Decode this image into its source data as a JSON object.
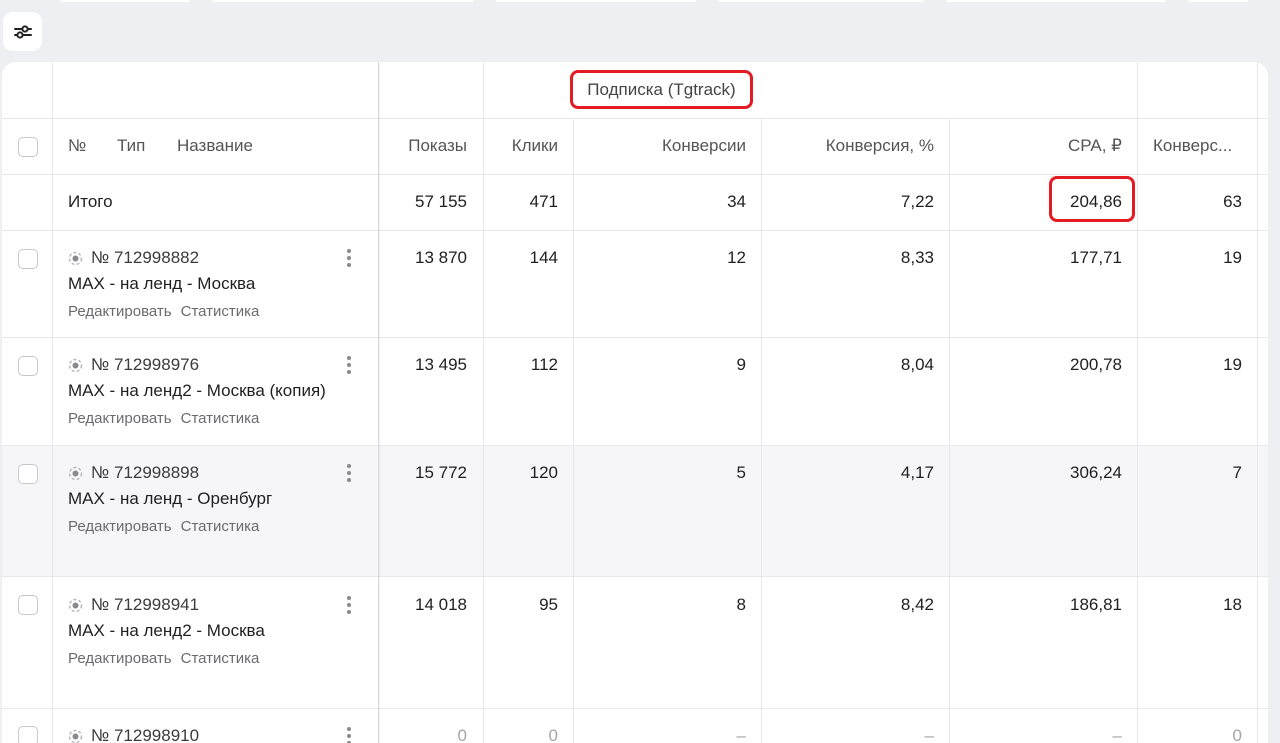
{
  "toolbar": {
    "settings_icon": "sliders-icon"
  },
  "group_header": {
    "label": "Подписка (Tgtrack)"
  },
  "columns": {
    "num": "№",
    "type": "Тип",
    "name": "Название",
    "shows": "Показы",
    "clicks": "Клики",
    "conversions": "Конверсии",
    "conv_rate": "Конверсия, %",
    "cpa": "CPA, ₽",
    "conv_more": "Конверс..."
  },
  "total": {
    "label": "Итого",
    "shows": "57 155",
    "clicks": "471",
    "conversions": "34",
    "conv_rate": "7,22",
    "cpa": "204,86",
    "conv_more": "63"
  },
  "rows": [
    {
      "id": "№ 712998882",
      "name": "MAX - на ленд - Москва",
      "edit": "Редактировать",
      "stats": "Статистика",
      "shows": "13 870",
      "clicks": "144",
      "conversions": "12",
      "conv_rate": "8,33",
      "cpa": "177,71",
      "conv_more": "19"
    },
    {
      "id": "№ 712998976",
      "name": "MAX - на ленд2 - Москва (копия)",
      "edit": "Редактировать",
      "stats": "Статистика",
      "shows": "13 495",
      "clicks": "112",
      "conversions": "9",
      "conv_rate": "8,04",
      "cpa": "200,78",
      "conv_more": "19"
    },
    {
      "id": "№ 712998898",
      "name": "MAX - на ленд - Оренбург",
      "edit": "Редактировать",
      "stats": "Статистика",
      "shows": "15 772",
      "clicks": "120",
      "conversions": "5",
      "conv_rate": "4,17",
      "cpa": "306,24",
      "conv_more": "7"
    },
    {
      "id": "№ 712998941",
      "name": "MAX - на ленд2 - Москва",
      "edit": "Редактировать",
      "stats": "Статистика",
      "shows": "14 018",
      "clicks": "95",
      "conversions": "8",
      "conv_rate": "8,42",
      "cpa": "186,81",
      "conv_more": "18"
    },
    {
      "id": "№ 712998910",
      "shows": "0",
      "clicks": "0",
      "conversions": "–",
      "conv_rate": "–",
      "cpa": "–",
      "conv_more": "0"
    }
  ],
  "colors": {
    "highlight": "#e31b23",
    "hover_row": "#f6f6f8"
  }
}
